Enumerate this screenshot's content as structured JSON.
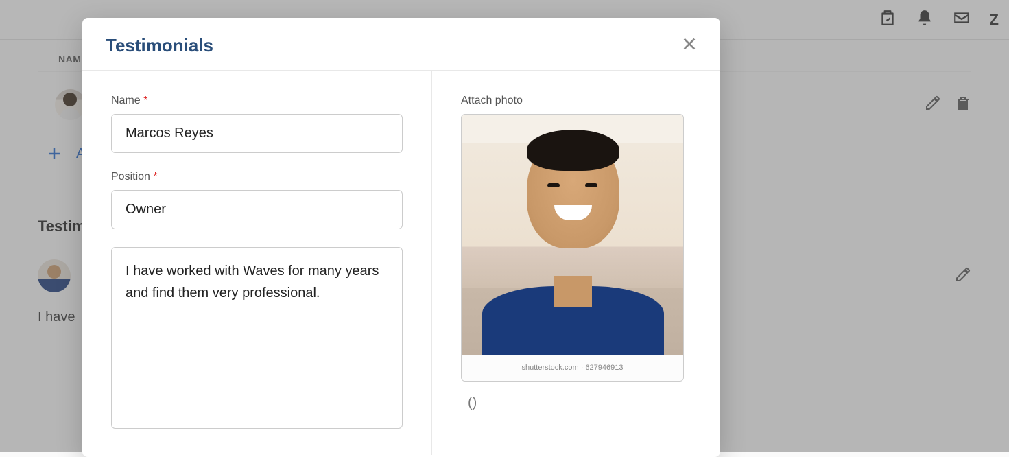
{
  "background": {
    "column_header": "NAM",
    "add_label": "A",
    "section_title": "Testim",
    "testimonial_preview": "I have"
  },
  "modal": {
    "title": "Testimonials",
    "fields": {
      "name": {
        "label": "Name",
        "required": true,
        "value": "Marcos Reyes"
      },
      "position": {
        "label": "Position",
        "required": true,
        "value": "Owner"
      },
      "testimonial": {
        "value": "I have worked with Waves for many years and find them very professional."
      },
      "photo": {
        "label": "Attach photo",
        "watermark": "shutterstock.com · 627946913",
        "meta": "()"
      }
    }
  }
}
